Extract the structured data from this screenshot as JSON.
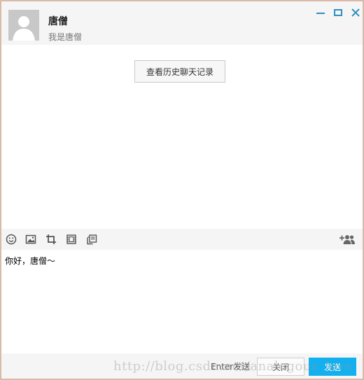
{
  "header": {
    "contact_name": "唐僧",
    "contact_signature": "我是唐僧"
  },
  "window_controls": {
    "minimize_icon": "minimize-icon",
    "maximize_icon": "maximize-icon",
    "close_icon": "close-icon"
  },
  "chat": {
    "history_button_label": "查看历史聊天记录"
  },
  "toolbar": {
    "icons": [
      "emoji-icon",
      "image-icon",
      "crop-icon",
      "film-icon",
      "message-history-icon",
      "add-contact-icon"
    ]
  },
  "input": {
    "current_value": "你好，唐僧～"
  },
  "footer": {
    "enter_hint": "Enter发送",
    "close_label": "关闭",
    "send_label": "发送"
  },
  "watermark": {
    "text": "http://blog.csdn.net/analogous_love"
  },
  "colors": {
    "send_button": "#12b0ef",
    "window_control_icon": "#2c8fc0",
    "background": "#f5f5f5",
    "chat_background": "#ffffff"
  }
}
